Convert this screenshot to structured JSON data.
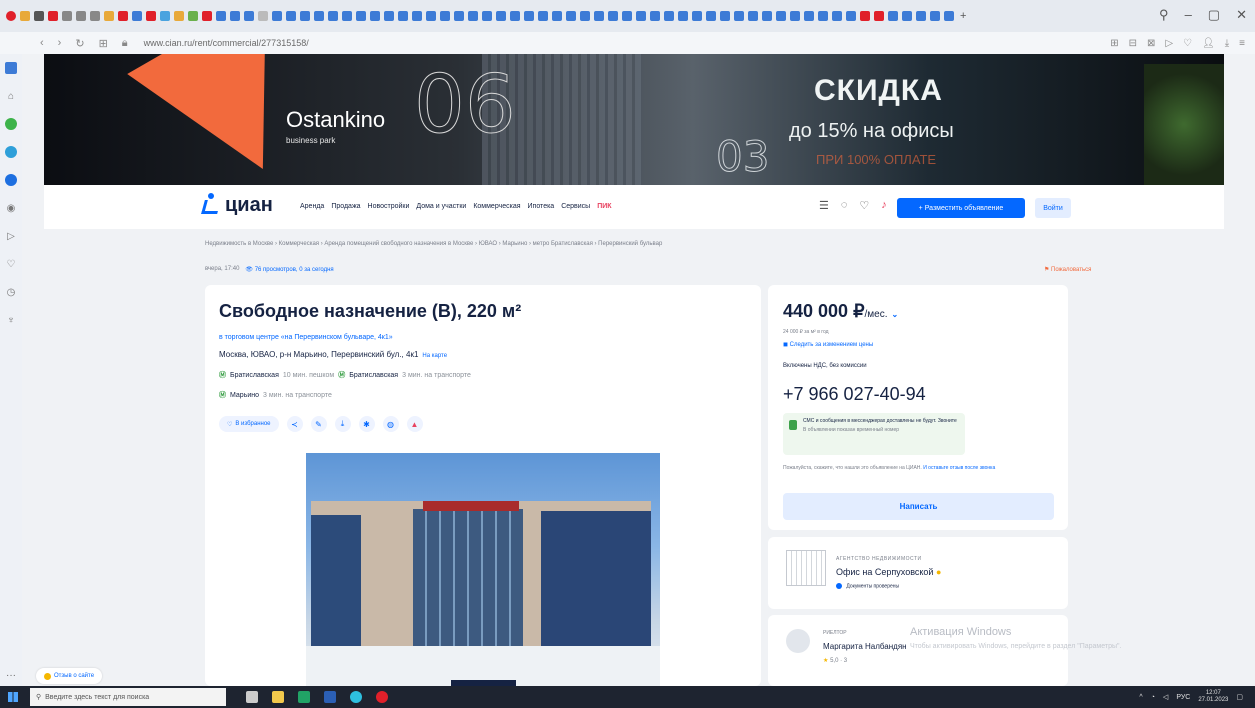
{
  "browser": {
    "address": "www.cian.ru/rent/commercial/277315158/",
    "nav_icons": [
      "back-icon",
      "forward-icon",
      "reload-icon",
      "home-icon"
    ]
  },
  "banner": {
    "brand": "Ostankino",
    "brand_sub": "business park",
    "big_number": "06",
    "small_number": "03",
    "headline": "СКИДКА",
    "subline": "до 15% на офисы",
    "offer": "ПРИ 100% ОПЛАТЕ"
  },
  "header": {
    "logo": "циан",
    "nav": [
      "Аренда",
      "Продажа",
      "Новостройки",
      "Дома и участки",
      "Коммерческая",
      "Ипотека",
      "Сервисы",
      "ПИК"
    ],
    "post_label": "+ Разместить объявление",
    "login_label": "Войти"
  },
  "breadcrumb": "Недвижимость в Москве › Коммерческая › Аренда помещений свободного назначения в Москве › ЮВАО › Марьино › метро Братиславская › Перервинский бульвар",
  "meta": {
    "updated": "вчера, 17:40",
    "views": "76 просмотров, 0 за сегодня",
    "complain": "Пожаловаться"
  },
  "listing": {
    "title": "Свободное назначение (В), 220 м²",
    "center": "в торговом центре «на Перервинском бульваре, 4к1»",
    "address": "Москва, ЮВАО, р-н Марьино, Перервинский бул., 4к1",
    "map_link": "На карте",
    "metro": [
      {
        "name": "Братиславская",
        "time": "10 мин. пешком"
      },
      {
        "name": "Братиславская",
        "time": "3 мин. на транспорте"
      },
      {
        "name": "Марьино",
        "time": "3 мин. на транспорте"
      }
    ],
    "fav_label": "В избранное"
  },
  "price": {
    "amount": "440 000 ₽",
    "unit": "/мес.",
    "per_meter": "24 000 ₽ за м² в год",
    "watch": "Следить за изменением цены",
    "vat": "Включены НДС, без комиссии",
    "phone": "+7 966 027-40-94",
    "sms_title": "СМС и сообщения в мессенджерах доставлены не будут. Звоните",
    "sms_sub": "В объявлении показан временный номер",
    "note_text": "Пожалуйста, скажите, что нашли это объявление на ЦИАН.",
    "note_link": "И оставьте отзыв после звонка",
    "write_label": "Написать"
  },
  "agency": {
    "kind": "АГЕНТСТВО НЕДВИЖИМОСТИ",
    "name": "Офис на Серпуховской",
    "docs": "Документы проверены"
  },
  "realtor": {
    "kind": "РИЕЛТОР",
    "name": "Маргарита Налбандян",
    "rating": "5,0 · 3"
  },
  "windows": {
    "activate": "Активация Windows",
    "activate_sub": "Чтобы активировать Windows, перейдите в раздел \"Параметры\"."
  },
  "feedback": "Отзыв о сайте",
  "taskbar": {
    "search_placeholder": "Введите здесь текст для поиска",
    "lang": "РУС",
    "time": "12:07",
    "date": "27.01.2023"
  }
}
